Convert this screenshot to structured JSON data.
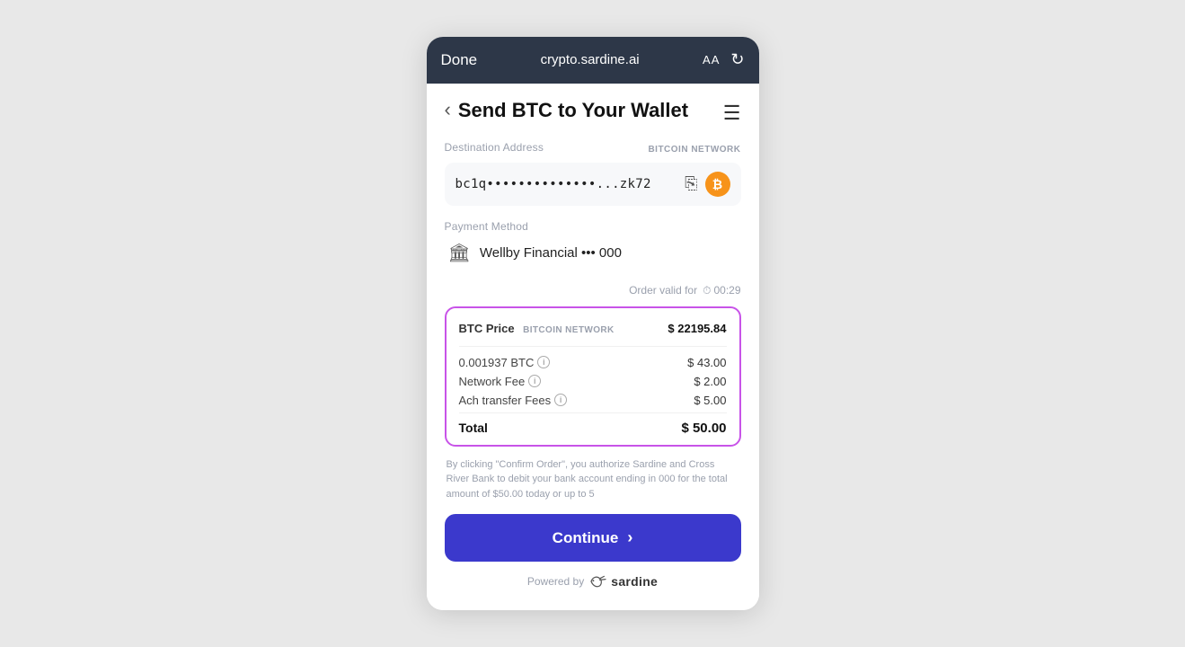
{
  "browser": {
    "done_label": "Done",
    "url": "crypto.sardine.ai",
    "font_size": "AA",
    "refresh_icon": "↻"
  },
  "header": {
    "back_icon": "‹",
    "title": "Send BTC to Your Wallet",
    "menu_icon": "☰"
  },
  "destination": {
    "label": "Destination Address",
    "network_badge": "BITCOIN NETWORK",
    "address_display": "bc1q••••••••••••••...zk72",
    "copy_icon": "⎘",
    "btc_icon": "₿"
  },
  "payment": {
    "label": "Payment Method",
    "bank_icon": "🏛",
    "bank_name": "Wellby Financial ••• 000"
  },
  "order": {
    "valid_label": "Order valid for",
    "clock_icon": "⏱",
    "timer": "00:29"
  },
  "price_box": {
    "btc_price_label": "BTC Price",
    "btc_price_network": "BITCOIN NETWORK",
    "btc_price_value": "$ 22195.84",
    "items": [
      {
        "label": "0.001937 BTC",
        "has_info": true,
        "value": "$ 43.00"
      },
      {
        "label": "Network Fee",
        "has_info": true,
        "value": "$ 2.00"
      },
      {
        "label": "Ach transfer Fees",
        "has_info": true,
        "value": "$ 5.00"
      }
    ],
    "total_label": "Total",
    "total_value": "$ 50.00"
  },
  "disclaimer": "By clicking \"Confirm Order\", you authorize Sardine and Cross River Bank to debit your bank account ending in 000 for the total amount of $50.00 today or up to 5",
  "continue_button": "Continue",
  "powered_by": "Powered by",
  "sardine_label": "sardine"
}
